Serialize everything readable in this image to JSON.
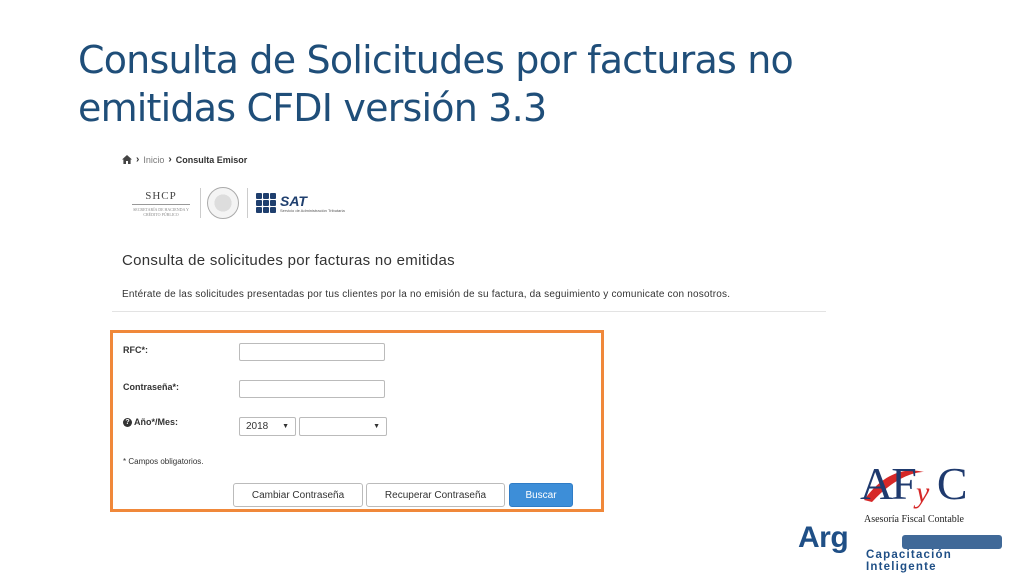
{
  "slide": {
    "title": "Consulta de Solicitudes por facturas no emitidas CFDI versión 3.3"
  },
  "breadcrumb": {
    "home_icon": "home-icon",
    "items": [
      "Inicio",
      "Consulta Emisor"
    ]
  },
  "logos": {
    "shcp": "SHCP",
    "shcp_sub": "SECRETARÍA DE HACIENDA Y CRÉDITO PÚBLICO",
    "sat": "SAT",
    "sat_sub": "Servicio de Administración Tributaria"
  },
  "page": {
    "title": "Consulta de solicitudes por facturas no emitidas",
    "description": "Entérate de las solicitudes presentadas por tus clientes por la no emisión de su factura, da seguimiento y comunicate con nosotros."
  },
  "form": {
    "rfc_label": "RFC*:",
    "rfc_value": "",
    "password_label": "Contraseña*:",
    "password_value": "",
    "year_month_label": "Año*/Mes:",
    "help_icon": "question-circle-icon",
    "year_selected": "2018",
    "month_selected": "",
    "required_note": "* Campos obligatorios.",
    "buttons": {
      "change_password": "Cambiar Contraseña",
      "recover_password": "Recuperar Contraseña",
      "search": "Buscar"
    },
    "highlight_color": "#f0883a"
  },
  "branding": {
    "afc_left": "AF",
    "afc_y": "y",
    "afc_right": "C",
    "afc_subtitle": "Asesoría Fiscal   Contable",
    "arg_word": "Arg",
    "arg_line1": "Capacitación",
    "arg_line2": "Inteligente"
  },
  "colors": {
    "title": "#1f4e79",
    "primary_button": "#3d8ed8",
    "brand_blue": "#1f4f86",
    "brand_red": "#d62828"
  }
}
